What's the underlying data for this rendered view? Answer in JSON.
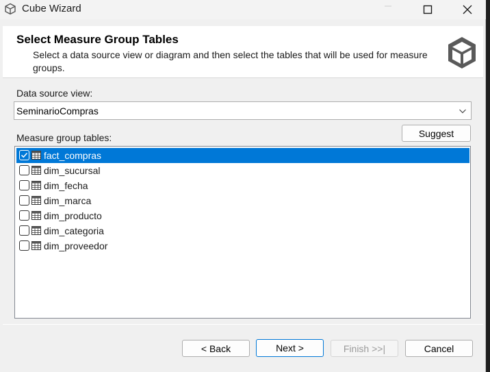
{
  "window": {
    "title": "Cube Wizard",
    "icons": {
      "app": "cube-outline-icon",
      "minimize": "minimize-icon",
      "maximize": "maximize-icon",
      "close": "close-icon"
    }
  },
  "header": {
    "title": "Select Measure Group Tables",
    "subtitle": "Select a data source view or diagram and then select the tables that will be used for measure groups.",
    "icon": "cube-icon"
  },
  "data_source_view": {
    "label": "Data source view:",
    "selected": "SeminarioCompras"
  },
  "measure_groups": {
    "label": "Measure group tables:",
    "suggest_label": "Suggest",
    "tables": [
      {
        "name": "fact_compras",
        "checked": true,
        "selected": true
      },
      {
        "name": "dim_sucursal",
        "checked": false,
        "selected": false
      },
      {
        "name": "dim_fecha",
        "checked": false,
        "selected": false
      },
      {
        "name": "dim_marca",
        "checked": false,
        "selected": false
      },
      {
        "name": "dim_producto",
        "checked": false,
        "selected": false
      },
      {
        "name": "dim_categoria",
        "checked": false,
        "selected": false
      },
      {
        "name": "dim_proveedor",
        "checked": false,
        "selected": false
      }
    ]
  },
  "footer": {
    "back_label": "< Back",
    "next_label": "Next >",
    "finish_label": "Finish >>|",
    "cancel_label": "Cancel"
  },
  "colors": {
    "selection": "#0078d7",
    "dialog_bg": "#f0f0f0"
  }
}
